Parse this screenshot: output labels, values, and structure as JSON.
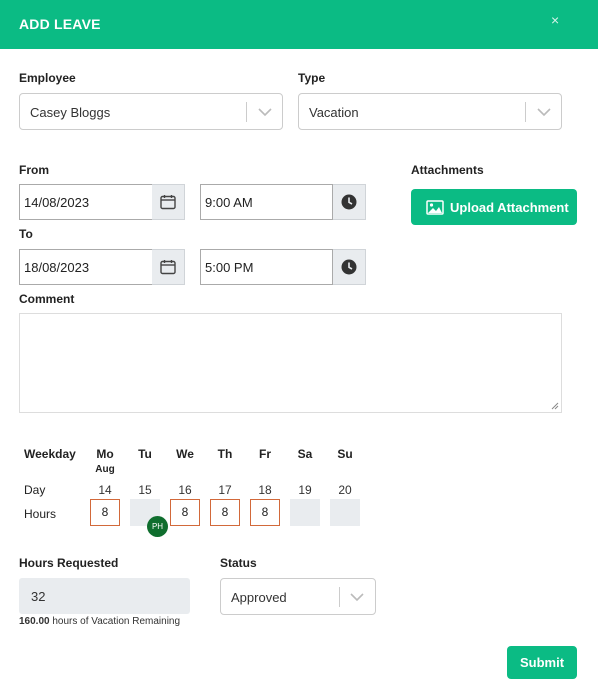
{
  "header": {
    "title": "ADD LEAVE",
    "close_glyph": "×"
  },
  "employee": {
    "label": "Employee",
    "value": "Casey Bloggs"
  },
  "type": {
    "label": "Type",
    "value": "Vacation"
  },
  "from": {
    "label": "From",
    "date": "14/08/2023",
    "time": "9:00 AM"
  },
  "to": {
    "label": "To",
    "date": "18/08/2023",
    "time": "5:00 PM"
  },
  "attachments": {
    "label": "Attachments",
    "button_label": "Upload Attachment"
  },
  "comment": {
    "label": "Comment",
    "value": ""
  },
  "schedule": {
    "weekday_label": "Weekday",
    "day_label": "Day",
    "hours_label": "Hours",
    "month": "Aug",
    "days": [
      {
        "weekday": "Mo",
        "day": "14",
        "hours": "8",
        "editable": true
      },
      {
        "weekday": "Tu",
        "day": "15",
        "hours": "",
        "editable": false,
        "badge": "PH"
      },
      {
        "weekday": "We",
        "day": "16",
        "hours": "8",
        "editable": true
      },
      {
        "weekday": "Th",
        "day": "17",
        "hours": "8",
        "editable": true
      },
      {
        "weekday": "Fr",
        "day": "18",
        "hours": "8",
        "editable": true
      },
      {
        "weekday": "Sa",
        "day": "19",
        "hours": "",
        "editable": false
      },
      {
        "weekday": "Su",
        "day": "20",
        "hours": "",
        "editable": false
      }
    ]
  },
  "hours_requested": {
    "label": "Hours Requested",
    "value": "32",
    "remaining_amount": "160.00",
    "remaining_text": "hours of Vacation Remaining"
  },
  "status": {
    "label": "Status",
    "value": "Approved"
  },
  "submit": {
    "label": "Submit"
  },
  "colors": {
    "accent": "#0bbb84",
    "hours_border": "#d2693a",
    "ph_badge": "#0f6e2e"
  },
  "icons": {
    "close": "close-icon",
    "dropdown": "chevron-down-icon",
    "calendar": "calendar-icon",
    "clock": "clock-icon",
    "image": "image-icon",
    "resize": "resize-grip-icon"
  }
}
